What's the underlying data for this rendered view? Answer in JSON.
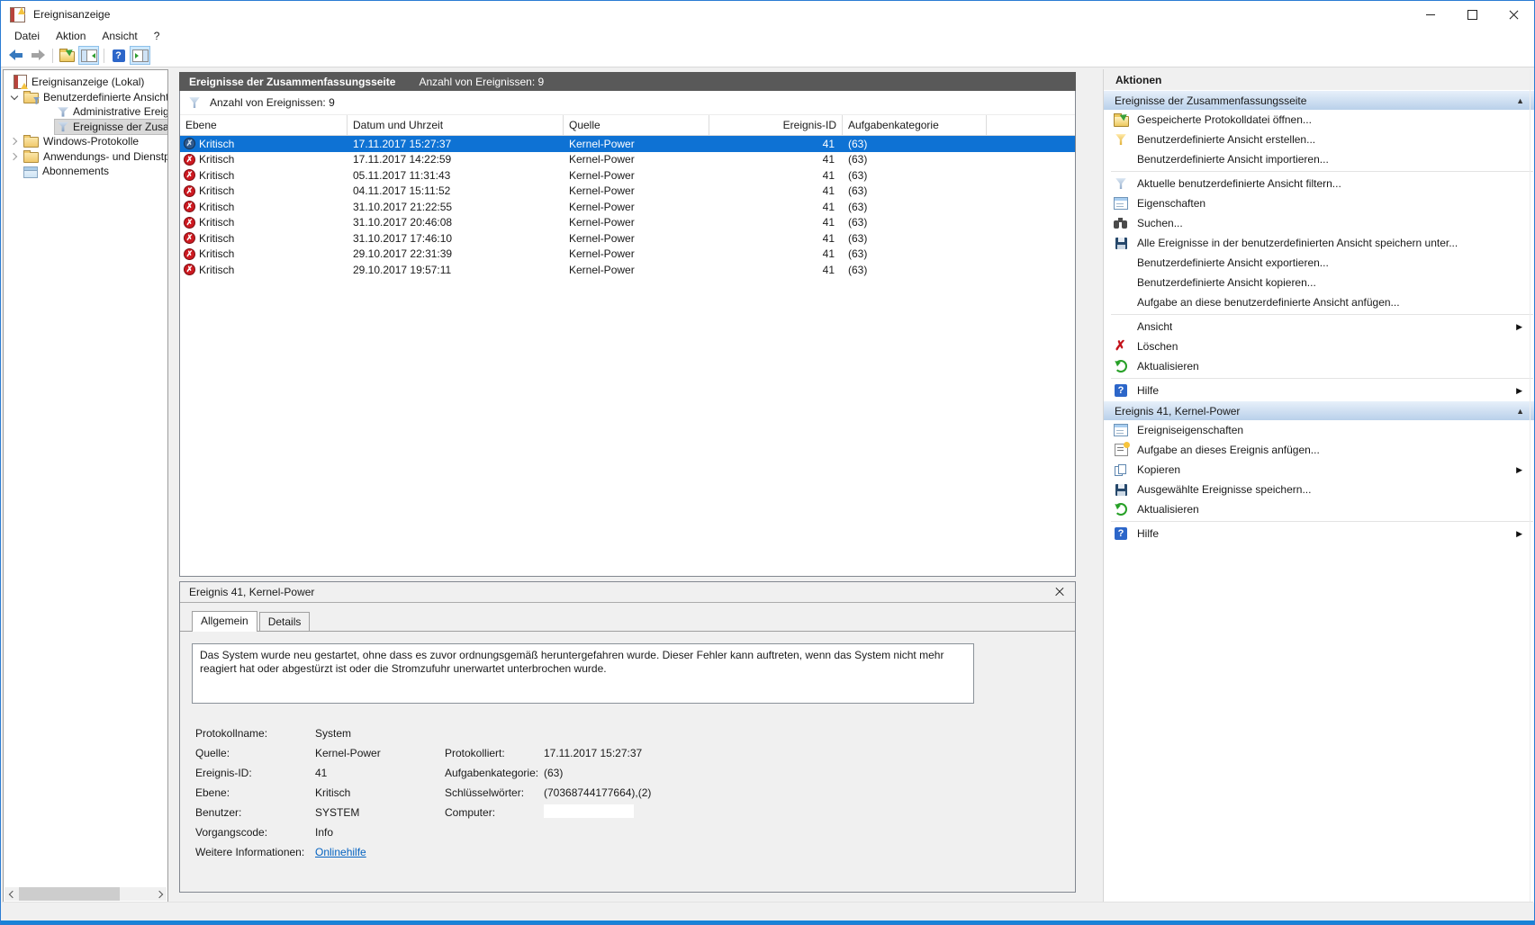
{
  "window": {
    "title": "Ereignisanzeige"
  },
  "menu": {
    "items": [
      "Datei",
      "Aktion",
      "Ansicht",
      "?"
    ]
  },
  "toolbar": {
    "items": [
      {
        "icon": "back-arrow"
      },
      {
        "icon": "forward-arrow"
      },
      {
        "type": "separator"
      },
      {
        "icon": "open-saved-log"
      },
      {
        "icon": "show-console-tree",
        "toggled": true
      },
      {
        "type": "separator"
      },
      {
        "icon": "help"
      },
      {
        "icon": "show-action-pane",
        "toggled": true
      }
    ]
  },
  "tree": {
    "items": [
      {
        "label": "Ereignisanzeige (Lokal)",
        "icon": "event-viewer-root",
        "level": 0,
        "expander": "none"
      },
      {
        "label": "Benutzerdefinierte Ansichten",
        "icon": "folder-views",
        "level": 1,
        "expander": "expanded"
      },
      {
        "label": "Administrative Ereignisse",
        "icon": "filter-view",
        "level": 2,
        "expander": "none"
      },
      {
        "label": "Ereignisse der Zusammenfassungsseite",
        "icon": "filter-view",
        "level": 2,
        "expander": "none",
        "selected": true
      },
      {
        "label": "Windows-Protokolle",
        "icon": "folder",
        "level": 1,
        "expander": "collapsed"
      },
      {
        "label": "Anwendungs- und Dienstprotokolle",
        "icon": "folder",
        "level": 1,
        "expander": "collapsed"
      },
      {
        "label": "Abonnements",
        "icon": "subscriptions",
        "level": 1,
        "expander": "none"
      }
    ]
  },
  "main": {
    "header_title": "Ereignisse der Zusammenfassungsseite",
    "header_count": "Anzahl von Ereignissen: 9",
    "filter_count": "Anzahl von Ereignissen: 9",
    "table": {
      "columns": [
        "Ebene",
        "Datum und Uhrzeit",
        "Quelle",
        "Ereignis-ID",
        "Aufgabenkategorie"
      ],
      "rows": [
        {
          "level": "Kritisch",
          "datetime": "17.11.2017 15:27:37",
          "source": "Kernel-Power",
          "event_id": "41",
          "category": "(63)",
          "selected": true
        },
        {
          "level": "Kritisch",
          "datetime": "17.11.2017 14:22:59",
          "source": "Kernel-Power",
          "event_id": "41",
          "category": "(63)"
        },
        {
          "level": "Kritisch",
          "datetime": "05.11.2017 11:31:43",
          "source": "Kernel-Power",
          "event_id": "41",
          "category": "(63)"
        },
        {
          "level": "Kritisch",
          "datetime": "04.11.2017 15:11:52",
          "source": "Kernel-Power",
          "event_id": "41",
          "category": "(63)"
        },
        {
          "level": "Kritisch",
          "datetime": "31.10.2017 21:22:55",
          "source": "Kernel-Power",
          "event_id": "41",
          "category": "(63)"
        },
        {
          "level": "Kritisch",
          "datetime": "31.10.2017 20:46:08",
          "source": "Kernel-Power",
          "event_id": "41",
          "category": "(63)"
        },
        {
          "level": "Kritisch",
          "datetime": "31.10.2017 17:46:10",
          "source": "Kernel-Power",
          "event_id": "41",
          "category": "(63)"
        },
        {
          "level": "Kritisch",
          "datetime": "29.10.2017 22:31:39",
          "source": "Kernel-Power",
          "event_id": "41",
          "category": "(63)"
        },
        {
          "level": "Kritisch",
          "datetime": "29.10.2017 19:57:11",
          "source": "Kernel-Power",
          "event_id": "41",
          "category": "(63)"
        }
      ]
    }
  },
  "details": {
    "title": "Ereignis 41, Kernel-Power",
    "tabs": [
      "Allgemein",
      "Details"
    ],
    "message": "Das System wurde neu gestartet, ohne dass es zuvor ordnungsgemäß heruntergefahren wurde. Dieser Fehler kann auftreten, wenn das System nicht mehr reagiert hat oder abgestürzt ist oder die Stromzufuhr unerwartet unterbrochen wurde.",
    "fields_left": [
      {
        "label": "Protokollname:",
        "value": "System"
      },
      {
        "label": "Quelle:",
        "value": "Kernel-Power"
      },
      {
        "label": "Ereignis-ID:",
        "value": "41"
      },
      {
        "label": "Ebene:",
        "value": "Kritisch"
      },
      {
        "label": "Benutzer:",
        "value": "SYSTEM"
      },
      {
        "label": "Vorgangscode:",
        "value": "Info"
      },
      {
        "label": "Weitere Informationen:",
        "value": "Onlinehilfe",
        "link": true
      }
    ],
    "fields_right": [
      {
        "label": "Protokolliert:",
        "value": "17.11.2017 15:27:37"
      },
      {
        "label": "Aufgabenkategorie:",
        "value": "(63)"
      },
      {
        "label": "Schlüsselwörter:",
        "value": "(70368744177664),(2)"
      },
      {
        "label": "Computer:",
        "value": "",
        "redacted": true
      }
    ]
  },
  "actions": {
    "title": "Aktionen",
    "sections": [
      {
        "header": "Ereignisse der Zusammenfassungsseite",
        "items": [
          {
            "label": "Gespeicherte Protokolldatei öffnen...",
            "icon": "open-folder"
          },
          {
            "label": "Benutzerdefinierte Ansicht erstellen...",
            "icon": "funnel-new"
          },
          {
            "label": "Benutzerdefinierte Ansicht importieren...",
            "icon": ""
          },
          {
            "label": "Aktuelle benutzerdefinierte Ansicht filtern...",
            "icon": "funnel",
            "divider_before": true
          },
          {
            "label": "Eigenschaften",
            "icon": "properties"
          },
          {
            "label": "Suchen...",
            "icon": "binoculars"
          },
          {
            "label": "Alle Ereignisse in der benutzerdefinierten Ansicht speichern unter...",
            "icon": "save"
          },
          {
            "label": "Benutzerdefinierte Ansicht exportieren...",
            "icon": ""
          },
          {
            "label": "Benutzerdefinierte Ansicht kopieren...",
            "icon": ""
          },
          {
            "label": "Aufgabe an diese benutzerdefinierte Ansicht anfügen...",
            "icon": ""
          },
          {
            "label": "Ansicht",
            "icon": "",
            "arrow": true,
            "divider_before": true
          },
          {
            "label": "Löschen",
            "icon": "delete"
          },
          {
            "label": "Aktualisieren",
            "icon": "refresh"
          },
          {
            "label": "Hilfe",
            "icon": "help",
            "arrow": true,
            "divider_before": true
          }
        ]
      },
      {
        "header": "Ereignis 41, Kernel-Power",
        "items": [
          {
            "label": "Ereigniseigenschaften",
            "icon": "properties"
          },
          {
            "label": "Aufgabe an dieses Ereignis anfügen...",
            "icon": "task"
          },
          {
            "label": "Kopieren",
            "icon": "copy",
            "arrow": true
          },
          {
            "label": "Ausgewählte Ereignisse speichern...",
            "icon": "save"
          },
          {
            "label": "Aktualisieren",
            "icon": "refresh"
          },
          {
            "label": "Hilfe",
            "icon": "help",
            "arrow": true,
            "divider_before": true
          }
        ]
      }
    ]
  }
}
